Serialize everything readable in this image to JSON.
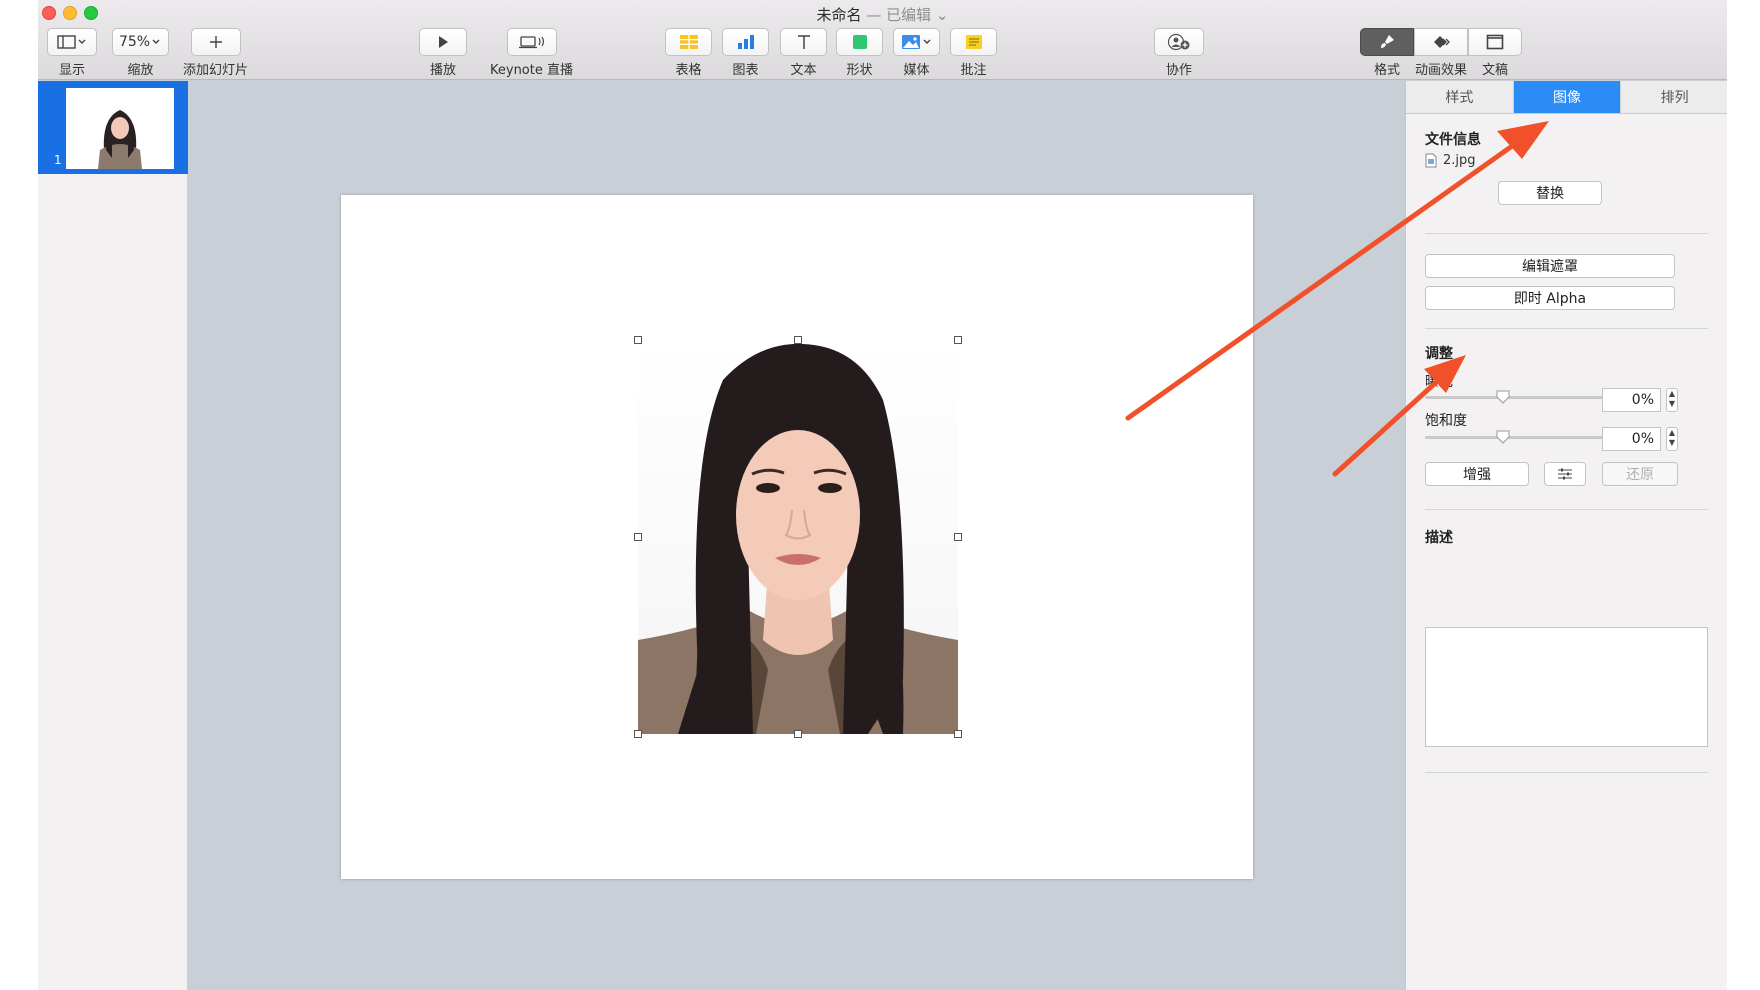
{
  "window": {
    "title": "未命名",
    "title_suffix": "— 已编辑 ⌄"
  },
  "toolbar": {
    "view": {
      "label": "显示"
    },
    "zoom": {
      "value": "75%",
      "label": "缩放"
    },
    "add_slide": {
      "label": "添加幻灯片"
    },
    "play": {
      "label": "播放"
    },
    "keynote_live": {
      "label": "Keynote 直播"
    },
    "table": {
      "label": "表格"
    },
    "chart": {
      "label": "图表"
    },
    "text": {
      "label": "文本"
    },
    "shape": {
      "label": "形状"
    },
    "media": {
      "label": "媒体"
    },
    "comment": {
      "label": "批注"
    },
    "collaborate": {
      "label": "协作"
    },
    "format": {
      "label": "格式"
    },
    "animate": {
      "label": "动画效果"
    },
    "document": {
      "label": "文稿"
    }
  },
  "navigator": {
    "slides": [
      {
        "number": "1"
      }
    ]
  },
  "inspector": {
    "tabs": [
      "样式",
      "图像",
      "排列"
    ],
    "active_tab": "图像",
    "file_info": {
      "title": "文件信息",
      "filename": "2.jpg",
      "replace_button": "替换"
    },
    "edit_mask_button": "编辑遮罩",
    "instant_alpha_button": "即时 Alpha",
    "adjust": {
      "title": "调整",
      "exposure": {
        "label": "曝光",
        "value": "0%"
      },
      "saturation": {
        "label": "饱和度",
        "value": "0%"
      },
      "enhance_button": "增强",
      "reset_button": "还原"
    },
    "description": {
      "title": "描述",
      "text": ""
    }
  },
  "colors": {
    "accent": "#2b8cf5",
    "selection": "#1870e4",
    "annotation_arrow": "#f0502a",
    "traffic_close": "#fe5f57",
    "traffic_min": "#febc2e",
    "traffic_max": "#28c840"
  }
}
